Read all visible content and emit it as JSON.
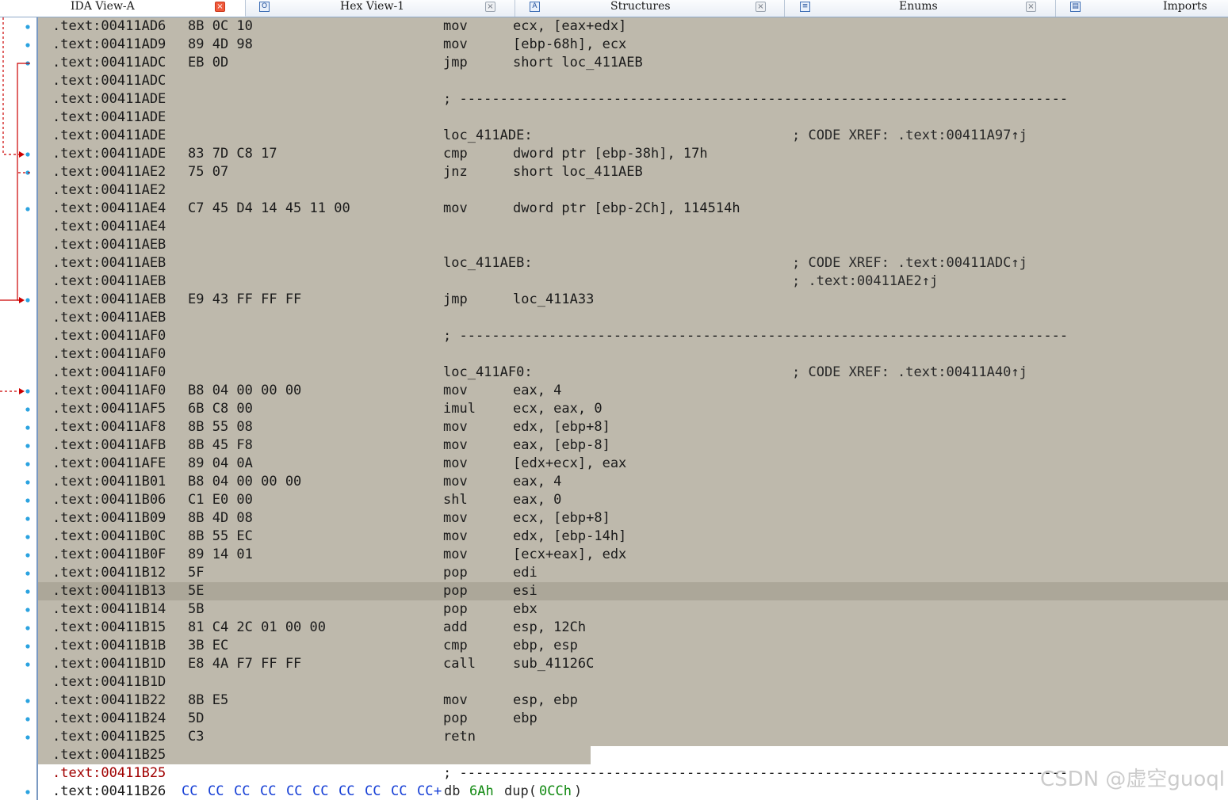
{
  "tabs": [
    {
      "label": "IDA View-A",
      "icon": "ida-view-icon",
      "active": true
    },
    {
      "label": "Hex View-1",
      "icon": "hex-view-icon",
      "active": false
    },
    {
      "label": "Structures",
      "icon": "structures-icon",
      "active": false
    },
    {
      "label": "Enums",
      "icon": "enums-icon",
      "active": false
    },
    {
      "label": "Imports",
      "icon": "imports-icon",
      "active": false
    }
  ],
  "colors": {
    "selection": "#beb9ac",
    "current_line": "#aca799",
    "gutter_arrow": "#cc0000",
    "breakpoint_dot": "#2ba3e0",
    "operand_bytes": "#1740d6",
    "operand_number": "#138a13"
  },
  "separator": "; ---------------------------------------------------------------------------",
  "lines": [
    {
      "addr": ".text:00411AD6",
      "bytes": "8B 0C 10",
      "mnem": "mov",
      "ops": "ecx, [eax+edx]",
      "comment": ""
    },
    {
      "addr": ".text:00411AD9",
      "bytes": "89 4D 98",
      "mnem": "mov",
      "ops": "[ebp-68h], ecx",
      "comment": ""
    },
    {
      "addr": ".text:00411ADC",
      "bytes": "EB 0D",
      "mnem": "jmp",
      "ops": "short loc_411AEB",
      "comment": ""
    },
    {
      "addr": ".text:00411ADC",
      "bytes": "",
      "mnem": "",
      "ops": "",
      "comment": ""
    },
    {
      "addr": ".text:00411ADE",
      "bytes": "",
      "mnem": "; ---------------------------------------------------------------------------",
      "ops": "",
      "comment": ""
    },
    {
      "addr": ".text:00411ADE",
      "bytes": "",
      "mnem": "",
      "ops": "",
      "comment": ""
    },
    {
      "addr": ".text:00411ADE",
      "bytes": "",
      "mnem": "loc_411ADE:",
      "ops": "",
      "comment": "; CODE XREF: .text:00411A97↑j"
    },
    {
      "addr": ".text:00411ADE",
      "bytes": "83 7D C8 17",
      "mnem": "cmp",
      "ops": "dword ptr [ebp-38h], 17h",
      "comment": ""
    },
    {
      "addr": ".text:00411AE2",
      "bytes": "75 07",
      "mnem": "jnz",
      "ops": "short loc_411AEB",
      "comment": ""
    },
    {
      "addr": ".text:00411AE2",
      "bytes": "",
      "mnem": "",
      "ops": "",
      "comment": ""
    },
    {
      "addr": ".text:00411AE4",
      "bytes": "C7 45 D4 14 45 11 00",
      "mnem": "mov",
      "ops": "dword ptr [ebp-2Ch], 114514h",
      "comment": ""
    },
    {
      "addr": ".text:00411AE4",
      "bytes": "",
      "mnem": "",
      "ops": "",
      "comment": ""
    },
    {
      "addr": ".text:00411AEB",
      "bytes": "",
      "mnem": "",
      "ops": "",
      "comment": ""
    },
    {
      "addr": ".text:00411AEB",
      "bytes": "",
      "mnem": "loc_411AEB:",
      "ops": "",
      "comment": "; CODE XREF: .text:00411ADC↑j"
    },
    {
      "addr": ".text:00411AEB",
      "bytes": "",
      "mnem": "",
      "ops": "",
      "comment": "; .text:00411AE2↑j"
    },
    {
      "addr": ".text:00411AEB",
      "bytes": "E9 43 FF FF FF",
      "mnem": "jmp",
      "ops": "loc_411A33",
      "comment": ""
    },
    {
      "addr": ".text:00411AEB",
      "bytes": "",
      "mnem": "",
      "ops": "",
      "comment": ""
    },
    {
      "addr": ".text:00411AF0",
      "bytes": "",
      "mnem": "; ---------------------------------------------------------------------------",
      "ops": "",
      "comment": ""
    },
    {
      "addr": ".text:00411AF0",
      "bytes": "",
      "mnem": "",
      "ops": "",
      "comment": ""
    },
    {
      "addr": ".text:00411AF0",
      "bytes": "",
      "mnem": "loc_411AF0:",
      "ops": "",
      "comment": "; CODE XREF: .text:00411A40↑j"
    },
    {
      "addr": ".text:00411AF0",
      "bytes": "B8 04 00 00 00",
      "mnem": "mov",
      "ops": "eax, 4",
      "comment": ""
    },
    {
      "addr": ".text:00411AF5",
      "bytes": "6B C8 00",
      "mnem": "imul",
      "ops": "ecx, eax, 0",
      "comment": ""
    },
    {
      "addr": ".text:00411AF8",
      "bytes": "8B 55 08",
      "mnem": "mov",
      "ops": "edx, [ebp+8]",
      "comment": ""
    },
    {
      "addr": ".text:00411AFB",
      "bytes": "8B 45 F8",
      "mnem": "mov",
      "ops": "eax, [ebp-8]",
      "comment": ""
    },
    {
      "addr": ".text:00411AFE",
      "bytes": "89 04 0A",
      "mnem": "mov",
      "ops": "[edx+ecx], eax",
      "comment": ""
    },
    {
      "addr": ".text:00411B01",
      "bytes": "B8 04 00 00 00",
      "mnem": "mov",
      "ops": "eax, 4",
      "comment": ""
    },
    {
      "addr": ".text:00411B06",
      "bytes": "C1 E0 00",
      "mnem": "shl",
      "ops": "eax, 0",
      "comment": ""
    },
    {
      "addr": ".text:00411B09",
      "bytes": "8B 4D 08",
      "mnem": "mov",
      "ops": "ecx, [ebp+8]",
      "comment": ""
    },
    {
      "addr": ".text:00411B0C",
      "bytes": "8B 55 EC",
      "mnem": "mov",
      "ops": "edx, [ebp-14h]",
      "comment": ""
    },
    {
      "addr": ".text:00411B0F",
      "bytes": "89 14 01",
      "mnem": "mov",
      "ops": "[ecx+eax], edx",
      "comment": ""
    },
    {
      "addr": ".text:00411B12",
      "bytes": "5F",
      "mnem": "pop",
      "ops": "edi",
      "comment": ""
    },
    {
      "addr": ".text:00411B13",
      "bytes": "5E",
      "mnem": "pop",
      "ops": "esi",
      "comment": ""
    },
    {
      "addr": ".text:00411B14",
      "bytes": "5B",
      "mnem": "pop",
      "ops": "ebx",
      "comment": ""
    },
    {
      "addr": ".text:00411B15",
      "bytes": "81 C4 2C 01 00 00",
      "mnem": "add",
      "ops": "esp, 12Ch",
      "comment": ""
    },
    {
      "addr": ".text:00411B1B",
      "bytes": "3B EC",
      "mnem": "cmp",
      "ops": "ebp, esp",
      "comment": ""
    },
    {
      "addr": ".text:00411B1D",
      "bytes": "E8 4A F7 FF FF",
      "mnem": "call",
      "ops": "sub_41126C",
      "comment": ""
    },
    {
      "addr": ".text:00411B1D",
      "bytes": "",
      "mnem": "",
      "ops": "",
      "comment": ""
    },
    {
      "addr": ".text:00411B22",
      "bytes": "8B E5",
      "mnem": "mov",
      "ops": "esp, ebp",
      "comment": ""
    },
    {
      "addr": ".text:00411B24",
      "bytes": "5D",
      "mnem": "pop",
      "ops": "ebp",
      "comment": ""
    },
    {
      "addr": ".text:00411B25",
      "bytes": "C3",
      "mnem": "retn",
      "ops": "",
      "comment": ""
    },
    {
      "addr": ".text:00411B25",
      "bytes": "",
      "mnem": "",
      "ops": "",
      "comment": ""
    },
    {
      "addr": ".text:00411B25",
      "bytes": "",
      "mnem": "; ---------------------------------------------------------------------------",
      "ops": "",
      "comment": ""
    }
  ],
  "last_line": {
    "addr": ".text:00411B26",
    "cc_bytes": [
      "CC",
      "CC",
      "CC",
      "CC",
      "CC",
      "CC",
      "CC",
      "CC",
      "CC",
      "CC"
    ],
    "plus": "+",
    "directive": "db",
    "count": "6Ah",
    "dup_open": "dup(",
    "dup_value": "0CCh",
    "dup_close": ")"
  },
  "watermark": "CSDN @虚空guoql"
}
